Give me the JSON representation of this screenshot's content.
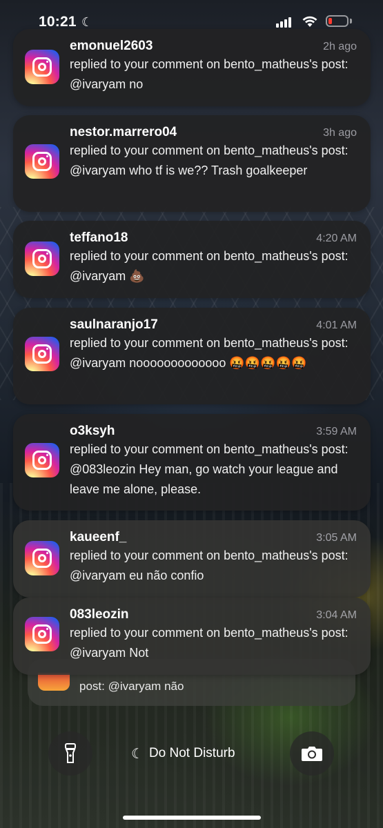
{
  "status_bar": {
    "time": "10:21",
    "focus_icon": "moon-icon",
    "battery_color": "#ff3b30"
  },
  "notifications": [
    {
      "user": "emonuel2603",
      "time": "2h ago",
      "text": "replied to your comment on bento_matheus's post: @ivaryam no"
    },
    {
      "user": "nestor.marrero04",
      "time": "3h ago",
      "text": "replied to your comment on bento_matheus's post: @ivaryam who tf is we?? Trash goalkeeper"
    },
    {
      "user": "teffano18",
      "time": "4:20 AM",
      "text": "replied to your comment on bento_matheus's post: @ivaryam 💩"
    },
    {
      "user": "saulnaranjo17",
      "time": "4:01 AM",
      "text": "replied to your comment on bento_matheus's post: @ivaryam nooooooooooooo 🤬🤬🤬🤬🤬"
    },
    {
      "user": "o3ksyh",
      "time": "3:59 AM",
      "text": "replied to your comment on bento_matheus's post: @083leozin Hey man, go watch your league and leave me alone, please."
    },
    {
      "user": "kaueenf_",
      "time": "3:05 AM",
      "text": "replied to your comment on bento_matheus's post: @ivaryam eu não confio"
    },
    {
      "user": "083leozin",
      "time": "3:04 AM",
      "text": "replied to your comment on bento_matheus's post: @ivaryam Not"
    }
  ],
  "stacked_notification": {
    "text": "post: @ivaryam não"
  },
  "lock_controls": {
    "flashlight_icon": "flashlight-icon",
    "dnd_label": "Do Not Disturb",
    "camera_icon": "camera-icon"
  },
  "app_icon": "instagram-icon"
}
